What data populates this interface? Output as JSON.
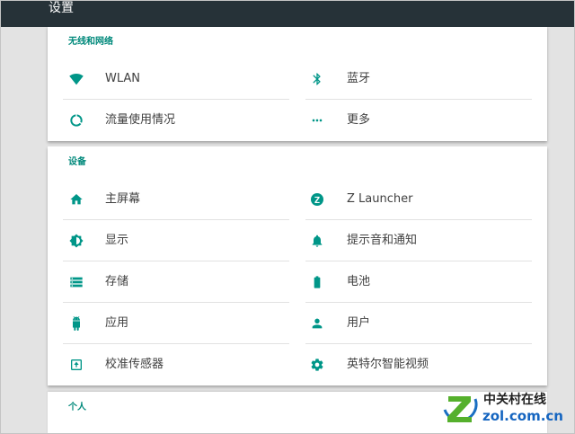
{
  "app": {
    "title": "设置"
  },
  "sections": [
    {
      "header": "无线和网络",
      "items": [
        {
          "label": "WLAN",
          "icon": "wifi-icon"
        },
        {
          "label": "蓝牙",
          "icon": "bluetooth-icon"
        },
        {
          "label": "流量使用情况",
          "icon": "data-usage-icon"
        },
        {
          "label": "更多",
          "icon": "more-icon"
        }
      ]
    },
    {
      "header": "设备",
      "items": [
        {
          "label": "主屏幕",
          "icon": "home-icon"
        },
        {
          "label": "Z Launcher",
          "icon": "z-launcher-icon"
        },
        {
          "label": "显示",
          "icon": "display-icon"
        },
        {
          "label": "提示音和通知",
          "icon": "bell-icon"
        },
        {
          "label": "存储",
          "icon": "storage-icon"
        },
        {
          "label": "电池",
          "icon": "battery-icon"
        },
        {
          "label": "应用",
          "icon": "android-icon"
        },
        {
          "label": "用户",
          "icon": "person-icon"
        },
        {
          "label": "校准传感器",
          "icon": "calibrate-icon"
        },
        {
          "label": "英特尔智能视频",
          "icon": "gear-icon"
        }
      ]
    },
    {
      "header": "个人",
      "items": []
    }
  ],
  "colors": {
    "accent": "#009688",
    "toolbar": "#263238",
    "background": "#e3e3e3"
  },
  "watermark": {
    "name": "中关村在线",
    "url": "zol.com.cn"
  }
}
